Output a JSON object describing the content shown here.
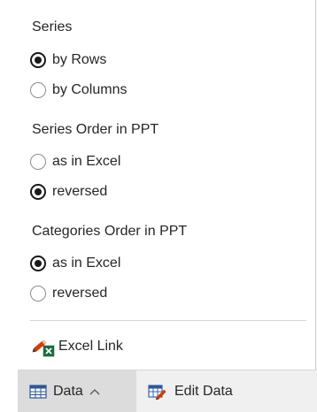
{
  "popup": {
    "series": {
      "title": "Series",
      "options": [
        {
          "label": "by Rows",
          "checked": true
        },
        {
          "label": "by Columns",
          "checked": false
        }
      ]
    },
    "series_order": {
      "title": "Series Order in PPT",
      "options": [
        {
          "label": "as in Excel",
          "checked": false
        },
        {
          "label": "reversed",
          "checked": true
        }
      ]
    },
    "categories_order": {
      "title": "Categories Order in PPT",
      "options": [
        {
          "label": "as in Excel",
          "checked": true
        },
        {
          "label": "reversed",
          "checked": false
        }
      ]
    },
    "excel_link": {
      "label": "Excel Link",
      "icon": "excel-link-icon"
    }
  },
  "bottom_bar": {
    "data_tab": {
      "label": "Data",
      "icon": "table-icon",
      "chevron": "chevron-up-icon",
      "active": true
    },
    "edit_tab": {
      "label": "Edit Data",
      "icon": "edit-data-icon"
    }
  },
  "colors": {
    "active_tab_bg": "#dcdcdc",
    "bar_bg": "#f0f0f0",
    "pencil_red": "#d83b01",
    "excel_green": "#1d6f42",
    "table_blue": "#2b579a"
  }
}
